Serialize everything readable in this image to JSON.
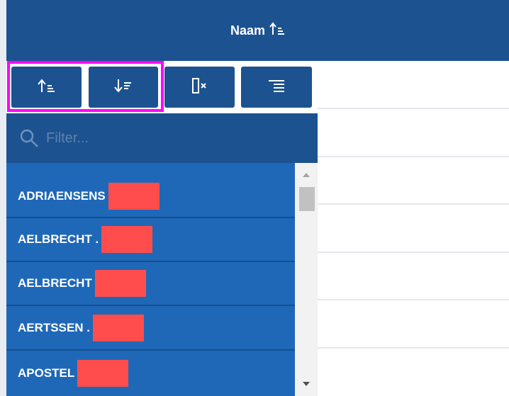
{
  "header": {
    "title": "Naam",
    "sort_icon": "sort-ascending-icon"
  },
  "toolbar": {
    "buttons": [
      {
        "icon": "sort-ascending-icon"
      },
      {
        "icon": "sort-descending-icon"
      },
      {
        "icon": "clear-column-icon"
      },
      {
        "icon": "align-right-icon"
      }
    ],
    "highlight_color": "#ff00ff"
  },
  "filter": {
    "placeholder": "Filter...",
    "icon": "search-icon"
  },
  "list": {
    "items": [
      {
        "label": "ADRIAENSENS"
      },
      {
        "label": "AELBRECHT ."
      },
      {
        "label": "AELBRECHT"
      },
      {
        "label": "AERTSSEN ."
      },
      {
        "label": "APOSTEL"
      }
    ],
    "redaction_color": "#ff4d4d"
  },
  "colors": {
    "header_bg": "#1c5290",
    "list_bg": "#1f68b8",
    "accent": "#ff00ff"
  }
}
